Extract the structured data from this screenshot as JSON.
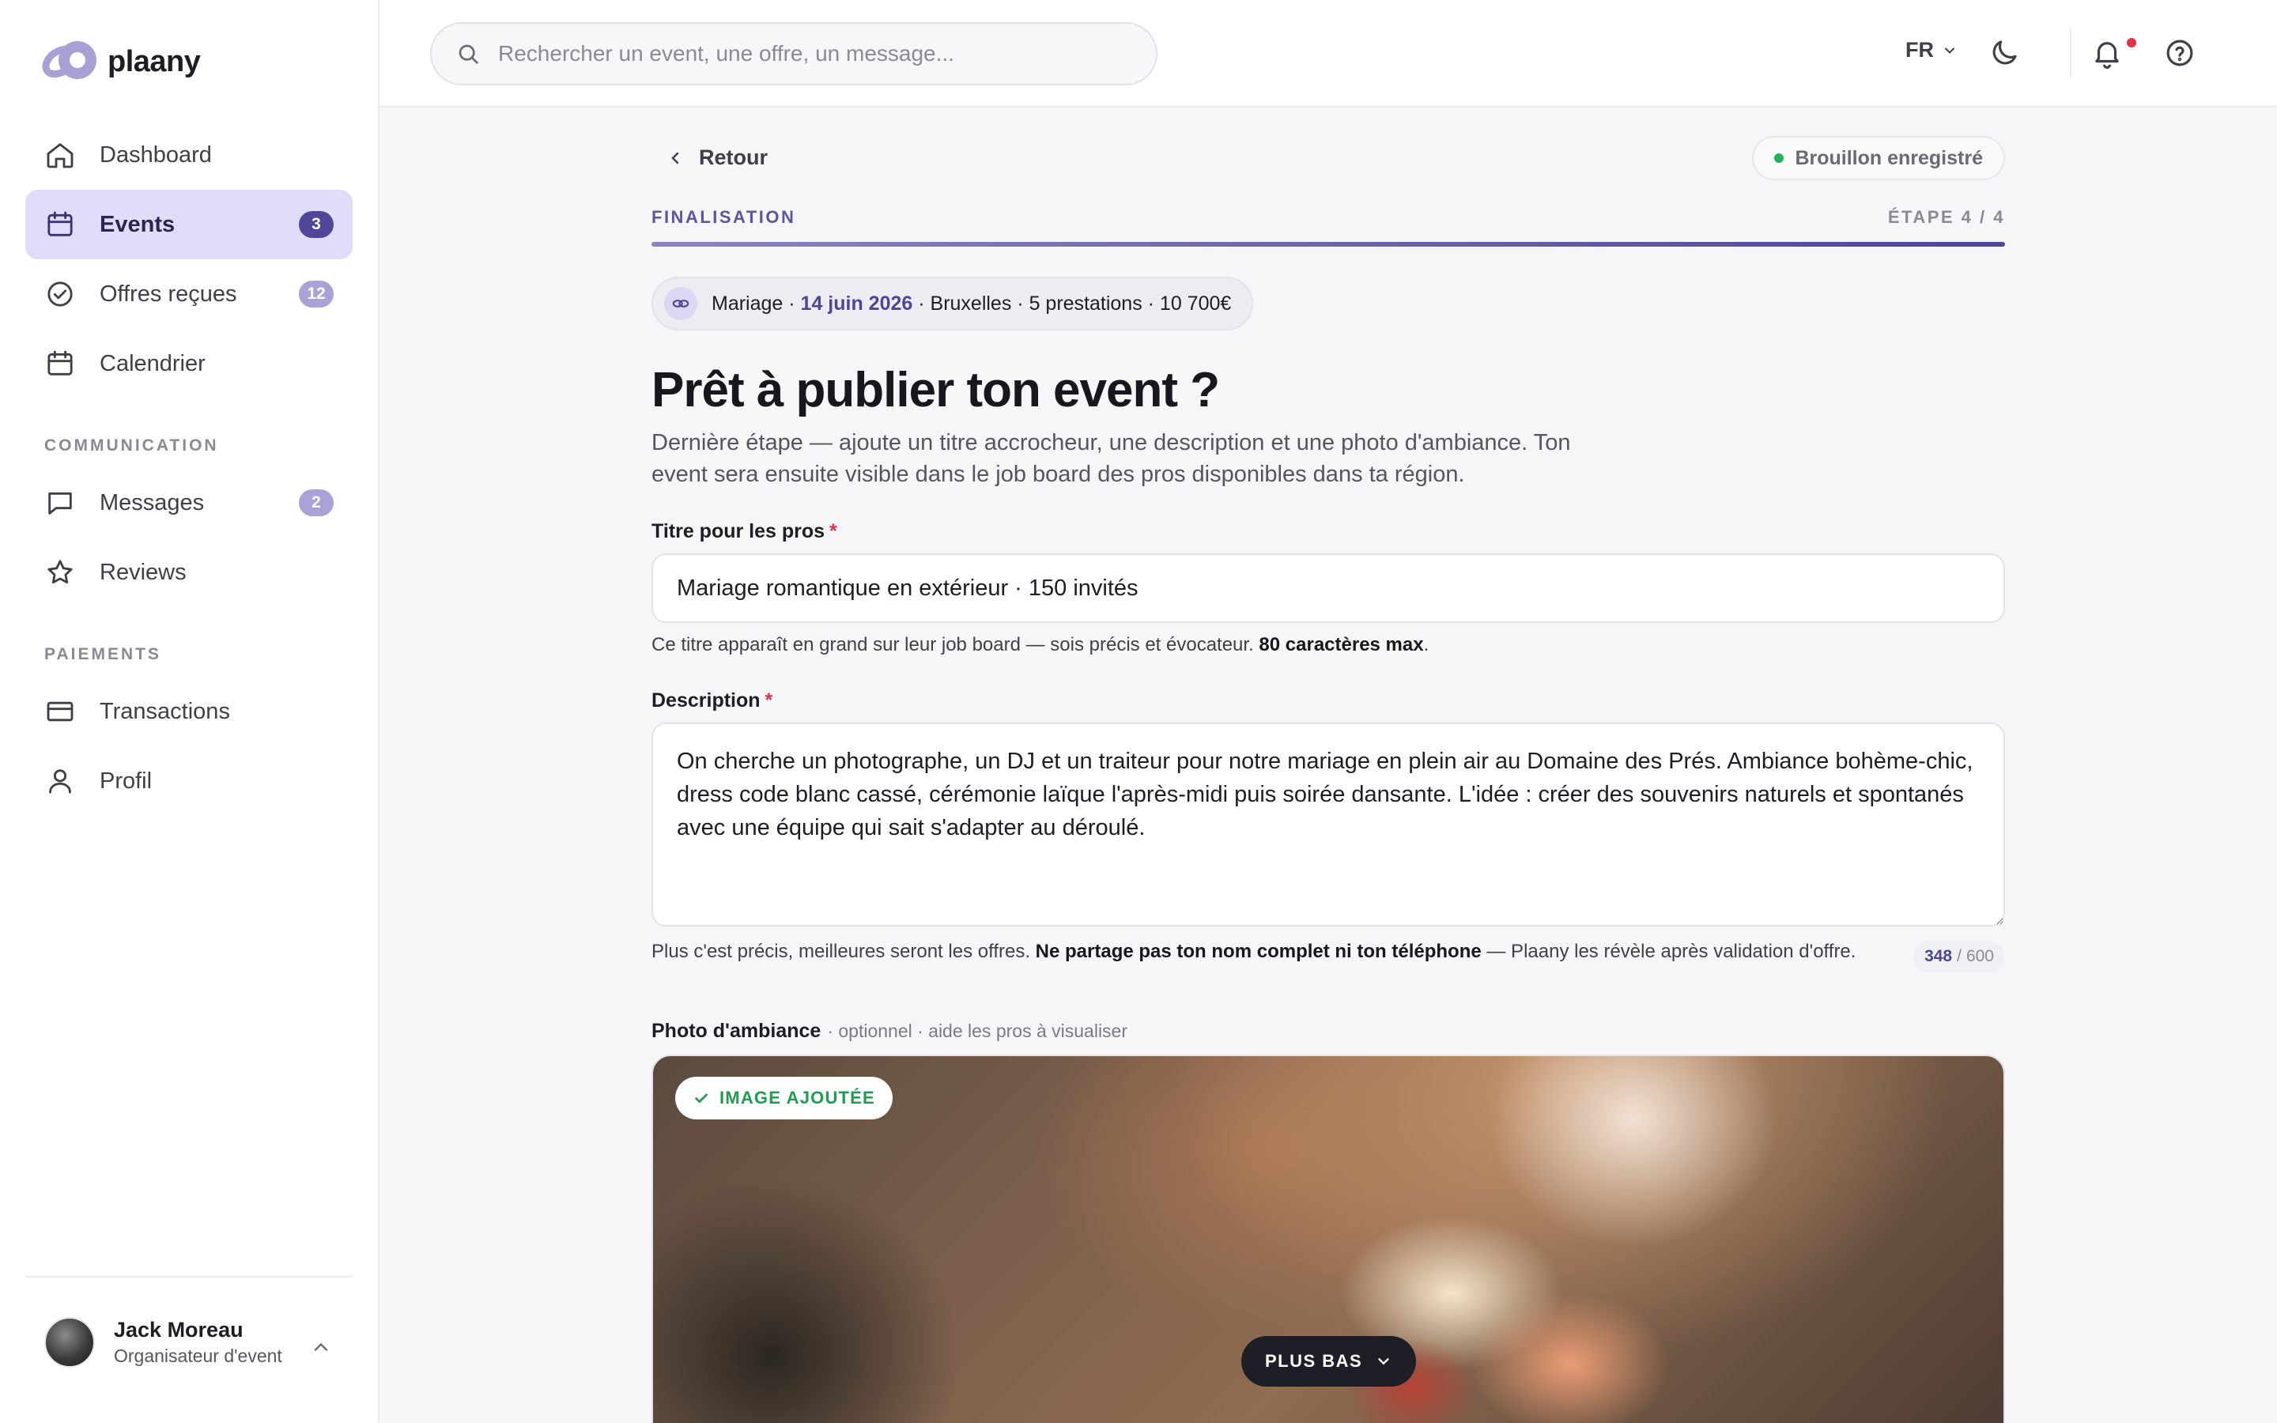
{
  "brand": {
    "name": "plaany"
  },
  "sidebar": {
    "items": [
      {
        "label": "Dashboard",
        "icon": "home-icon"
      },
      {
        "label": "Events",
        "icon": "calendar-icon",
        "badge": "3",
        "active": true
      },
      {
        "label": "Offres reçues",
        "icon": "check-circle-icon",
        "badge": "12"
      },
      {
        "label": "Calendrier",
        "icon": "calendar-icon"
      }
    ],
    "communication_label": "COMMUNICATION",
    "communication_items": [
      {
        "label": "Messages",
        "icon": "message-icon",
        "badge": "2"
      },
      {
        "label": "Reviews",
        "icon": "star-icon"
      }
    ],
    "payments_label": "PAIEMENTS",
    "payments_items": [
      {
        "label": "Transactions",
        "icon": "card-icon"
      },
      {
        "label": "Profil",
        "icon": "user-icon"
      }
    ],
    "user": {
      "name": "Jack Moreau",
      "role": "Organisateur d'event"
    }
  },
  "topbar": {
    "search_placeholder": "Rechercher un event, une offre, un message...",
    "language": "FR"
  },
  "main": {
    "back_label": "Retour",
    "draft_status": "Brouillon enregistré",
    "step_label": "FINALISATION",
    "step_count": "ÉTAPE 4 / 4",
    "progress": 1.0,
    "summary": {
      "type": "Mariage",
      "date": "14 juin 2026",
      "city": "Bruxelles",
      "services": "5 prestations",
      "budget": "10 700€",
      "sep": " · "
    },
    "title": "Prêt à publier ton event ?",
    "subtitle": "Dernière étape — ajoute un titre accrocheur, une description et une photo d'ambiance. Ton event sera ensuite visible dans le job board des pros disponibles dans ta région.",
    "title_field": {
      "label": "Titre pour les pros",
      "required_mark": "*",
      "value": "Mariage romantique en extérieur · 150 invités",
      "hint_prefix": "Ce titre apparaît en grand sur leur job board — sois précis et évocateur. ",
      "hint_bold": "80 caractères max",
      "hint_suffix": "."
    },
    "description_field": {
      "label": "Description",
      "required_mark": "*",
      "value": "On cherche un photographe, un DJ et un traiteur pour notre mariage en plein air au Domaine des Prés. Ambiance bohème-chic, dress code blanc cassé, cérémonie laïque l'après-midi puis soirée dansante. L'idée : créer des souvenirs naturels et spontanés avec une équipe qui sait s'adapter au déroulé.",
      "hint_prefix": "Plus c'est précis, meilleures seront les offres. ",
      "hint_bold": "Ne partage pas ton nom complet ni ton téléphone",
      "hint_suffix": " — Plaany les révèle après validation d'offre.",
      "count": "348",
      "count_sep": "/",
      "max": "600"
    },
    "photo_field": {
      "label": "Photo d'ambiance",
      "optional_note": "· optionnel · aide les pros à visualiser",
      "badge": "IMAGE AJOUTÉE"
    },
    "scroll_button": "PLUS BAS"
  },
  "colors": {
    "accent": "#4d4699",
    "accent_light": "#e2dcfb",
    "success": "#1f9d4f",
    "required": "#e0344a"
  }
}
